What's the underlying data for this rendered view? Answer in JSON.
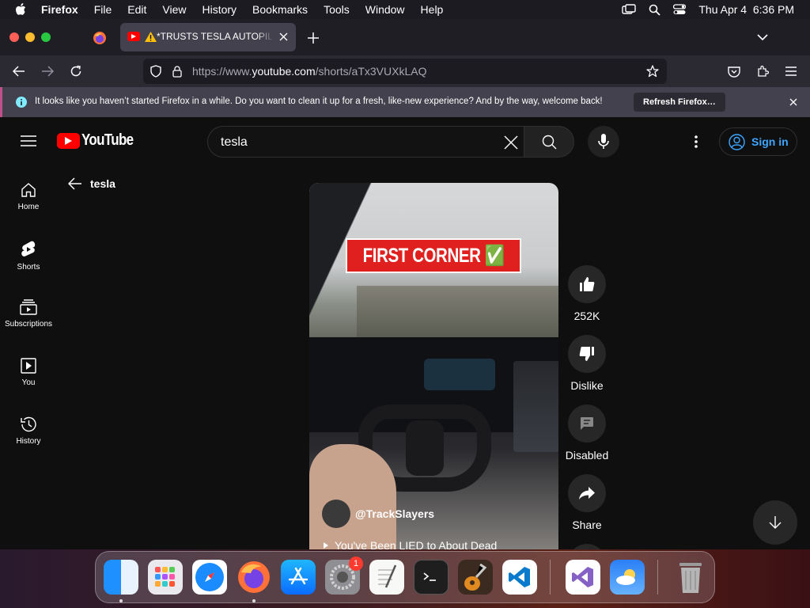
{
  "menubar": {
    "app": "Firefox",
    "items": [
      "File",
      "Edit",
      "View",
      "History",
      "Bookmarks",
      "Tools",
      "Window",
      "Help"
    ],
    "clock": "Thu Apr 4  6:36 PM"
  },
  "tab": {
    "title": "*TRUSTS TESLA AUTOPILOT"
  },
  "nav": {
    "url_prefix": "https://www.",
    "url_domain": "youtube.com",
    "url_path": "/shorts/aTx3VUXkLAQ"
  },
  "notification": {
    "text": "It looks like you haven’t started Firefox in a while. Do you want to clean it up for a fresh, like-new experience? And by the way, welcome back!",
    "button": "Refresh Firefox…"
  },
  "youtube": {
    "logo": "YouTube",
    "search_value": "tesla",
    "sign_in": "Sign in",
    "back_label": "tesla",
    "sidebar": [
      {
        "label": "Home",
        "icon": "home-icon"
      },
      {
        "label": "Shorts",
        "icon": "shorts-icon"
      },
      {
        "label": "Subscriptions",
        "icon": "subscriptions-icon"
      },
      {
        "label": "You",
        "icon": "you-icon"
      },
      {
        "label": "History",
        "icon": "history-icon"
      }
    ],
    "video": {
      "overlay_text": "FIRST CORNER ✅",
      "channel": "@TrackSlayers",
      "caption": "You've Been LIED to About Dead"
    },
    "actions": {
      "like_count": "252K",
      "dislike": "Dislike",
      "comments": "Disabled",
      "share": "Share"
    }
  },
  "dock": {
    "badge": "1"
  },
  "colors": {
    "yt_red": "#ff0000",
    "signin_blue": "#3ea6ff",
    "overlay_red": "#e0201f"
  }
}
